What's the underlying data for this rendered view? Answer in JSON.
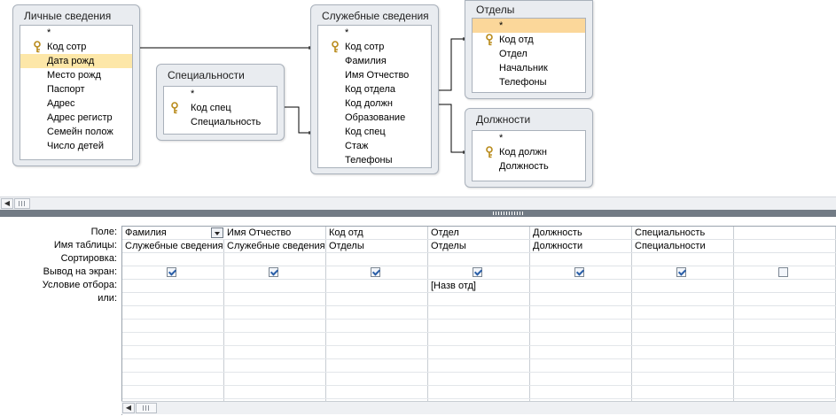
{
  "tables": {
    "personal": {
      "title": "Личные сведения",
      "fields": [
        "*",
        "Код сотр",
        "Дата рожд",
        "Место рожд",
        "Паспорт",
        "Адрес",
        "Адрес регистр",
        "Семейн полож",
        "Число детей"
      ]
    },
    "specialties": {
      "title": "Специальности",
      "fields": [
        "*",
        "Код спец",
        "Специальность"
      ]
    },
    "employees": {
      "title": "Служебные сведения",
      "fields": [
        "*",
        "Код сотр",
        "Фамилия",
        "Имя Отчество",
        "Код отдела",
        "Код должн",
        "Образование",
        "Код спец",
        "Стаж",
        "Телефоны"
      ]
    },
    "departments": {
      "title": "Отделы",
      "fields": [
        "*",
        "Код отд",
        "Отдел",
        "Начальник",
        "Телефоны"
      ]
    },
    "positions": {
      "title": "Должности",
      "fields": [
        "*",
        "Код должн",
        "Должность"
      ]
    }
  },
  "grid": {
    "row_labels": [
      "Поле:",
      "Имя таблицы:",
      "Сортировка:",
      "Вывод на экран:",
      "Условие отбора:",
      "или:"
    ],
    "columns": [
      {
        "field": "Фамилия",
        "table": "Служебные сведения",
        "show": true,
        "criteria": ""
      },
      {
        "field": "Имя Отчество",
        "table": "Служебные сведения",
        "show": true,
        "criteria": ""
      },
      {
        "field": "Код отд",
        "table": "Отделы",
        "show": true,
        "criteria": ""
      },
      {
        "field": "Отдел",
        "table": "Отделы",
        "show": true,
        "criteria": "[Назв отд]"
      },
      {
        "field": "Должность",
        "table": "Должности",
        "show": true,
        "criteria": ""
      },
      {
        "field": "Специальность",
        "table": "Специальности",
        "show": true,
        "criteria": ""
      },
      {
        "field": "",
        "table": "",
        "show": false,
        "criteria": ""
      }
    ]
  },
  "icons": {
    "key": "primary-key-icon",
    "scroll_left": "scroll-left-arrow-icon",
    "scroll_grip": "scroll-grip-icon"
  }
}
